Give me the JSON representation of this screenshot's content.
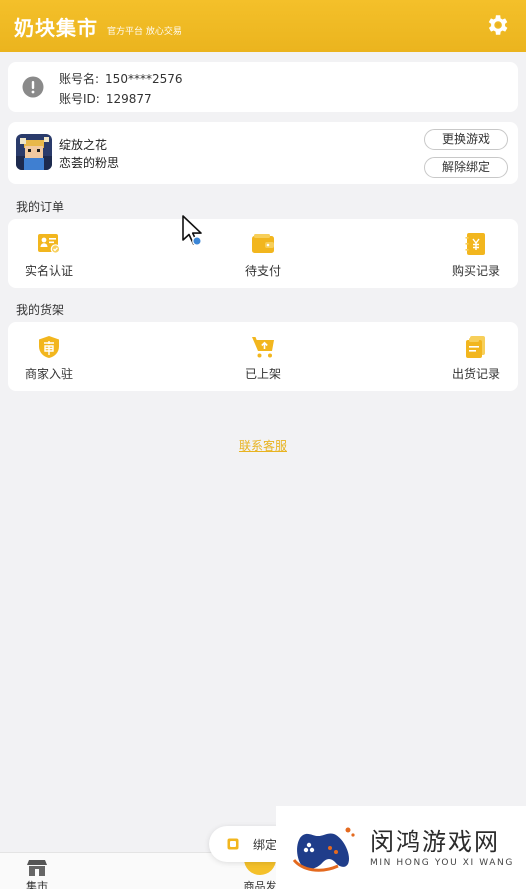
{
  "header": {
    "title": "奶块集市",
    "slogan": "官方平台 放心交易"
  },
  "account": {
    "name_label": "账号名:",
    "name_value": "150****2576",
    "id_label": "账号ID:",
    "id_value": "129877"
  },
  "game": {
    "game_name": "绽放之花",
    "role_name": "恋荟的粉思",
    "switch_label": "更换游戏",
    "unbind_label": "解除绑定"
  },
  "orders": {
    "title": "我的订单",
    "items": [
      {
        "label": "实名认证",
        "icon": "id-card-icon"
      },
      {
        "label": "待支付",
        "icon": "wallet-icon"
      },
      {
        "label": "购买记录",
        "icon": "purchase-record-icon"
      }
    ]
  },
  "shelf": {
    "title": "我的货架",
    "items": [
      {
        "label": "商家入驻",
        "icon": "merchant-shield-icon"
      },
      {
        "label": "已上架",
        "icon": "cart-upload-icon"
      },
      {
        "label": "出货记录",
        "icon": "shipment-record-icon"
      }
    ]
  },
  "contact_label": "联系客服",
  "bind_toast": {
    "label": "绑定"
  },
  "bottom_nav": {
    "market_label": "集市",
    "publish_label": "商品发"
  },
  "watermark": {
    "title": "闵鸿游戏网",
    "subtitle": "MIN HONG YOU XI WANG"
  },
  "colors": {
    "accent": "#f4c02a",
    "link": "#e8b320",
    "background": "#f2f2f4"
  }
}
